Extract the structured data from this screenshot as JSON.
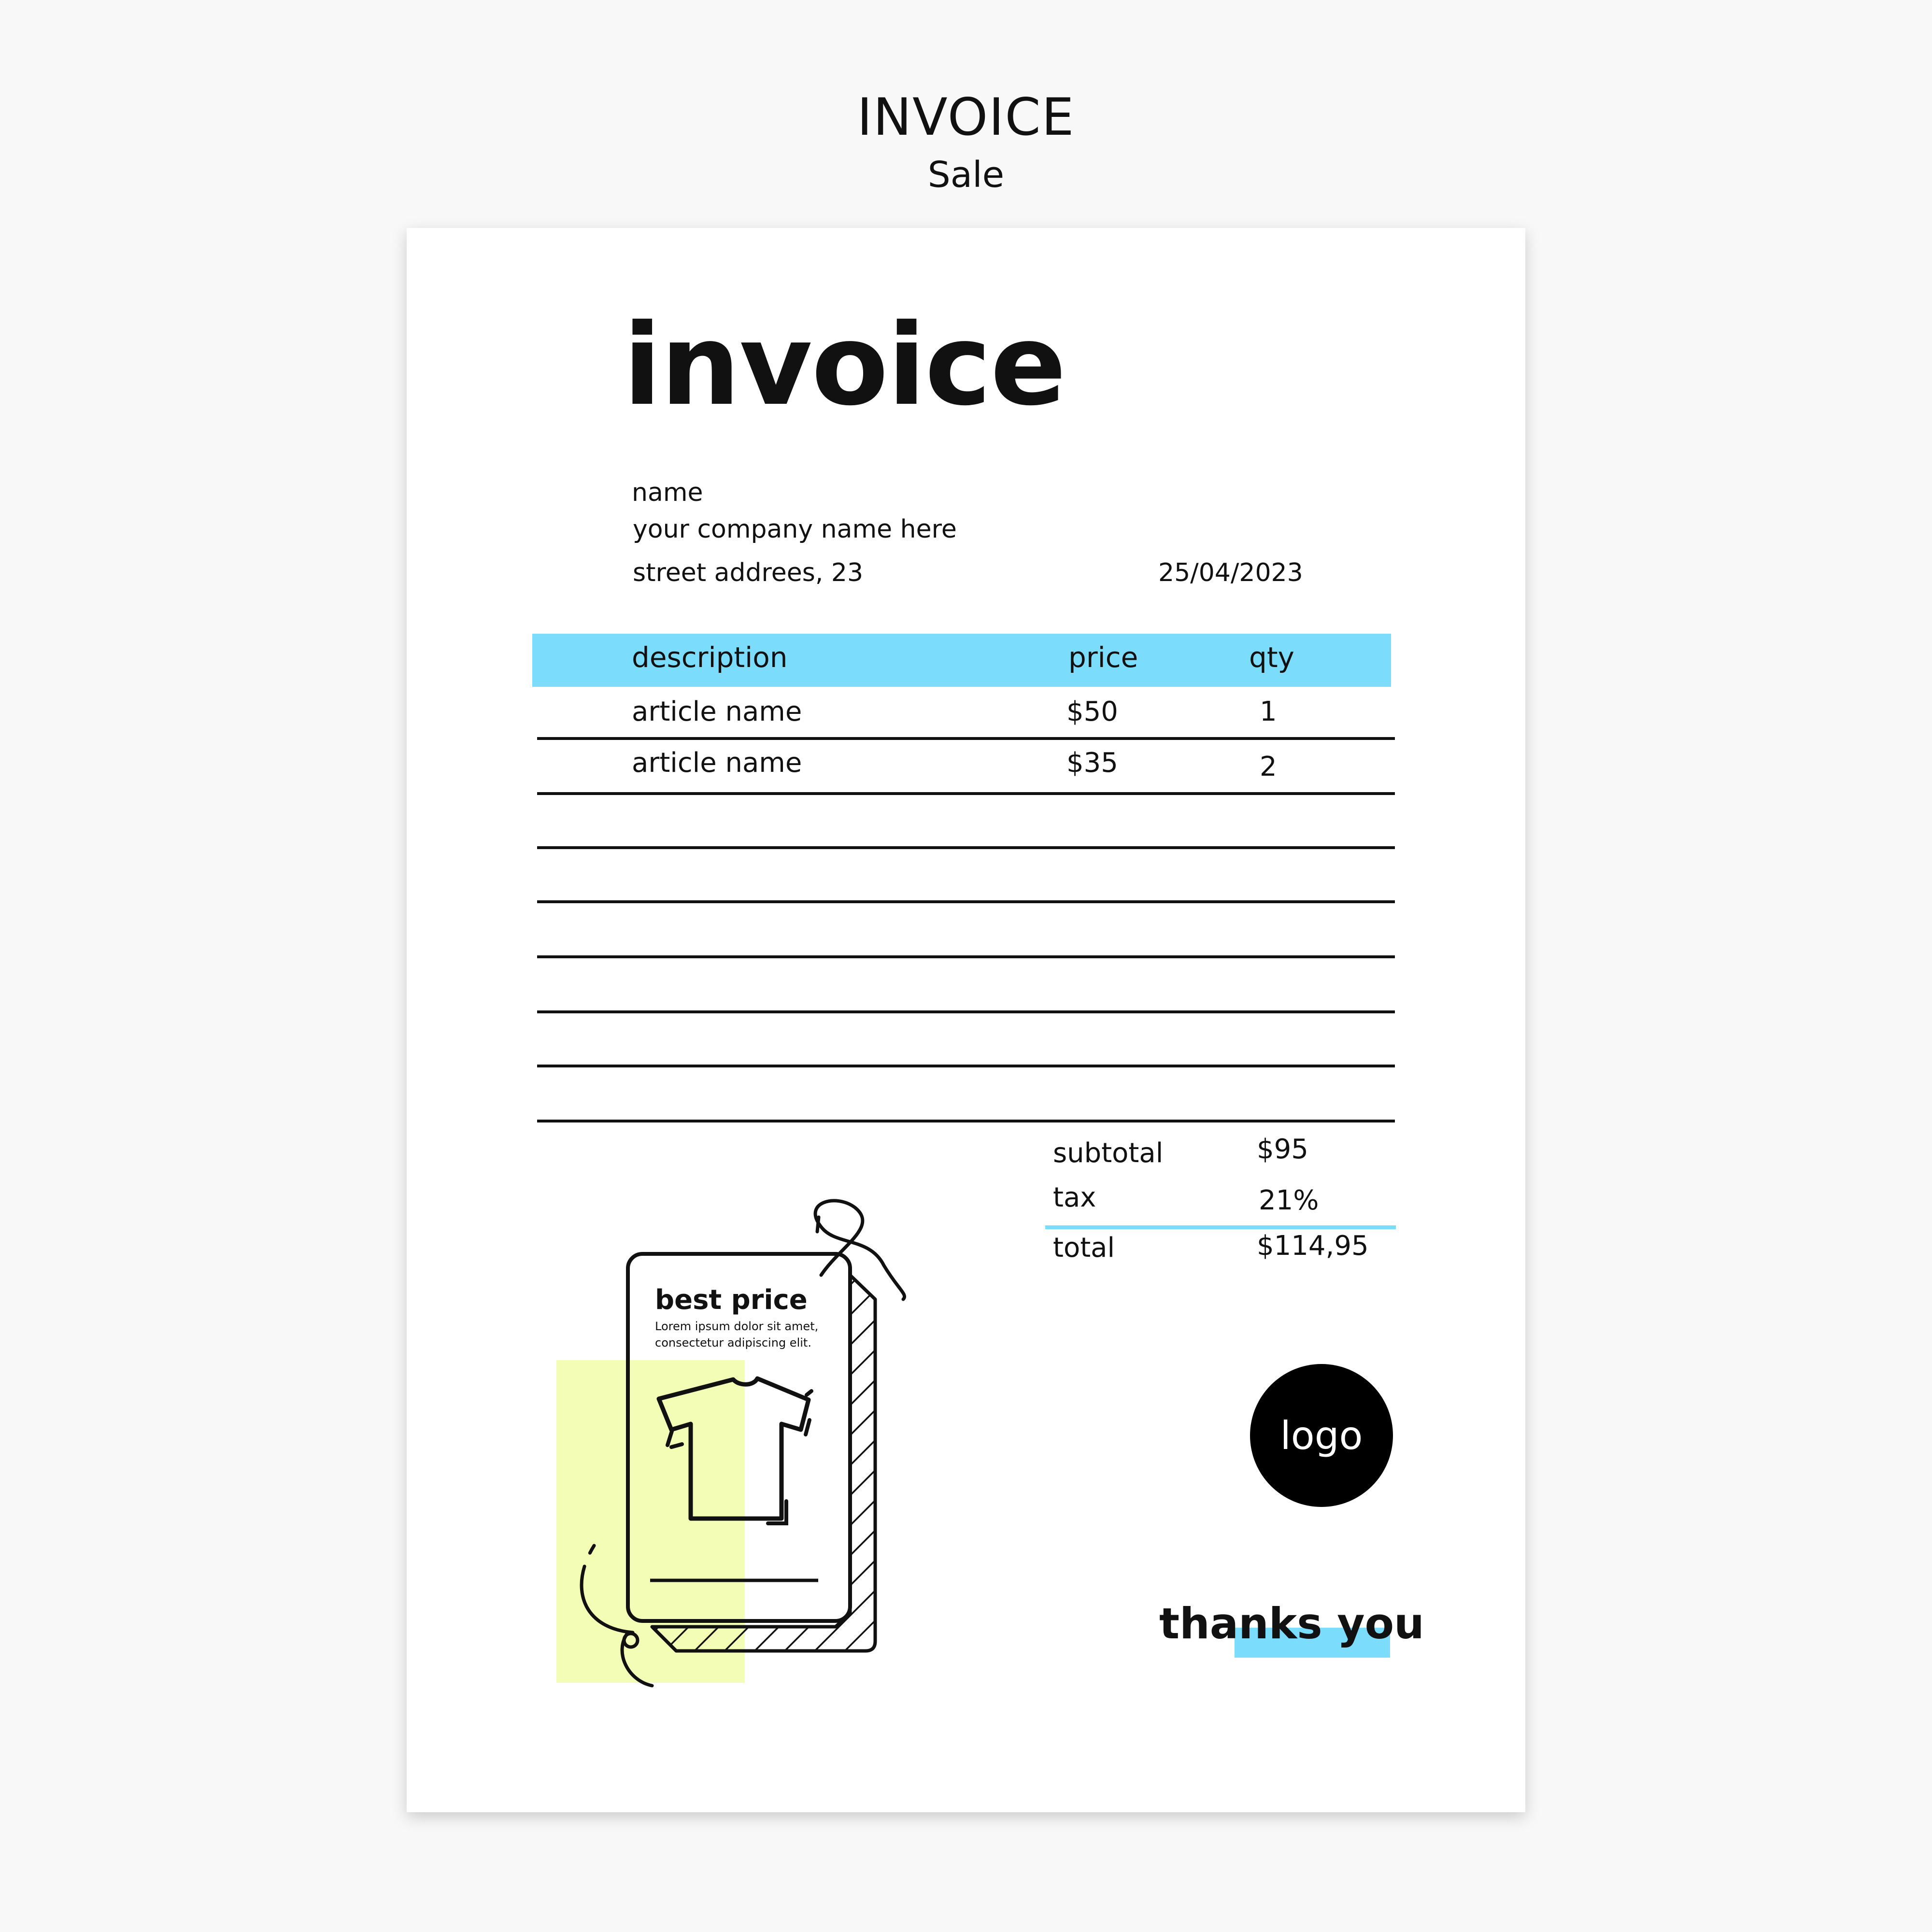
{
  "header": {
    "title": "INVOICE",
    "subtitle": "Sale"
  },
  "invoice": {
    "title": "invoice",
    "name_label": "name",
    "company": "your company name here",
    "address": "street addrees, 23",
    "date": "25/04/2023"
  },
  "table": {
    "headers": {
      "description": "description",
      "price": "price",
      "qty": "qty"
    },
    "rows": [
      {
        "description": "article name",
        "price": "$50",
        "qty": "1"
      },
      {
        "description": "article name",
        "price": "$35",
        "qty": "2"
      }
    ]
  },
  "totals": {
    "subtotal_label": "subtotal",
    "subtotal": "$95",
    "tax_label": "tax",
    "tax": "21%",
    "total_label": "total",
    "total": "$114,95"
  },
  "promo": {
    "title": "best price",
    "line1": "Lorem ipsum dolor sit amet,",
    "line2": "consectetur adipiscing elit.",
    "icon": "t-shirt-icon"
  },
  "footer": {
    "logo": "logo",
    "thanks": "thanks you"
  },
  "colors": {
    "accent_blue": "#7cdcfc",
    "accent_yellow": "#f4fdb6",
    "ink": "#111111"
  }
}
